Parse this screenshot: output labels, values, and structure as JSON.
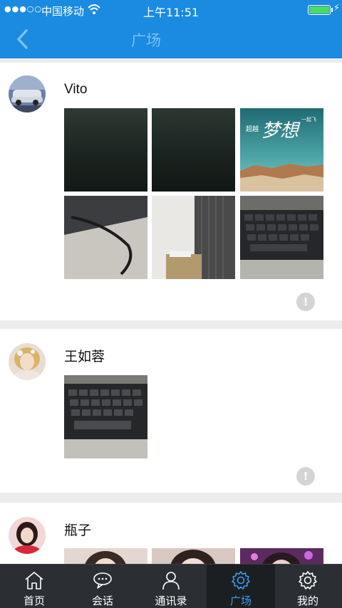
{
  "status_bar": {
    "signal": "●●●○○",
    "carrier": "中国移动",
    "time": "上午11:51",
    "charging_icon": "⚡"
  },
  "nav": {
    "title": "广场"
  },
  "posts": [
    {
      "username": "Vito"
    },
    {
      "username": "王如蓉"
    },
    {
      "username": "瓶子"
    }
  ],
  "image_text": {
    "chaoyue": "超越",
    "mengxiang": "梦想",
    "yiqifei": "一起飞"
  },
  "more_glyph": "!",
  "tabs": [
    {
      "label": "首页",
      "icon": "home-icon"
    },
    {
      "label": "会话",
      "icon": "chat-icon"
    },
    {
      "label": "通讯录",
      "icon": "contacts-icon"
    },
    {
      "label": "广场",
      "icon": "square-icon",
      "active": true
    },
    {
      "label": "我的",
      "icon": "settings-icon"
    }
  ],
  "colors": {
    "primary": "#1a8be0",
    "tab_active": "#3a9bf0",
    "tab_bar": "#2b2f33"
  }
}
